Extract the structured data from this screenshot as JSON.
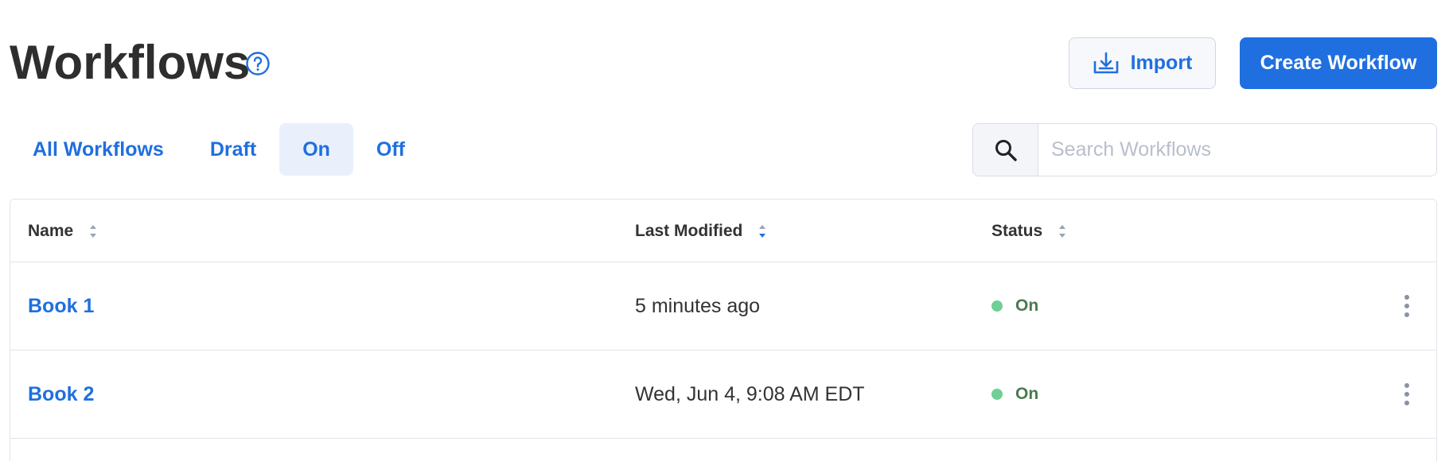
{
  "header": {
    "title": "Workflows",
    "import_label": "Import",
    "create_label": "Create Workflow"
  },
  "colors": {
    "accent": "#1f6fe0",
    "active_tab_bg": "#e9f0fc",
    "status_on": "#6fcf97"
  },
  "tabs": [
    {
      "label": "All Workflows",
      "active": false
    },
    {
      "label": "Draft",
      "active": false
    },
    {
      "label": "On",
      "active": true
    },
    {
      "label": "Off",
      "active": false
    }
  ],
  "search": {
    "placeholder": "Search Workflows",
    "value": ""
  },
  "table": {
    "columns": [
      {
        "label": "Name",
        "sort": "none"
      },
      {
        "label": "Last Modified",
        "sort": "desc"
      },
      {
        "label": "Status",
        "sort": "none"
      }
    ],
    "rows": [
      {
        "name": "Book 1",
        "modified": "5 minutes ago",
        "status": "On"
      },
      {
        "name": "Book 2",
        "modified": "Wed, Jun 4, 9:08 AM EDT",
        "status": "On"
      }
    ]
  },
  "icons": {
    "help": "help-circle-icon",
    "import": "import-tray-icon",
    "search": "magnifier-icon",
    "sort": "sort-arrows-icon",
    "row_menu": "kebab-menu-icon"
  }
}
